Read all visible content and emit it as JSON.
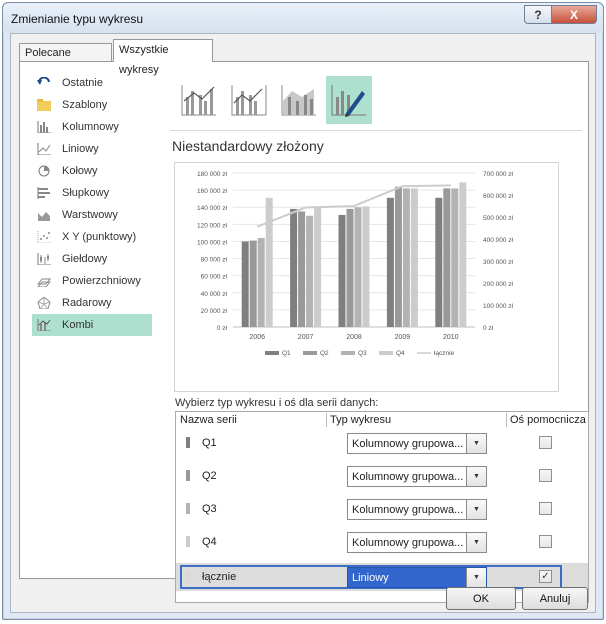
{
  "window": {
    "title": "Zmienianie typu wykresu",
    "help_label": "?",
    "close_label": "X"
  },
  "tabs": [
    {
      "label": "Polecane wykresy"
    },
    {
      "label": "Wszystkie wykresy"
    }
  ],
  "sidebar": {
    "items": [
      {
        "label": "Ostatnie",
        "icon": "undo-icon"
      },
      {
        "label": "Szablony",
        "icon": "folder-icon"
      },
      {
        "label": "Kolumnowy",
        "icon": "column-chart-icon"
      },
      {
        "label": "Liniowy",
        "icon": "line-chart-icon"
      },
      {
        "label": "Kołowy",
        "icon": "pie-chart-icon"
      },
      {
        "label": "Słupkowy",
        "icon": "bar-chart-icon"
      },
      {
        "label": "Warstwowy",
        "icon": "area-chart-icon"
      },
      {
        "label": "X Y (punktowy)",
        "icon": "scatter-chart-icon"
      },
      {
        "label": "Giełdowy",
        "icon": "stock-chart-icon"
      },
      {
        "label": "Powierzchniowy",
        "icon": "surface-chart-icon"
      },
      {
        "label": "Radarowy",
        "icon": "radar-chart-icon"
      },
      {
        "label": "Kombi",
        "icon": "combo-chart-icon",
        "selected": true
      }
    ]
  },
  "subtypes": {
    "selected_index": 3
  },
  "preview": {
    "title": "Niestandardowy złożony"
  },
  "chart_data": {
    "type": "bar",
    "categories": [
      "2006",
      "2007",
      "2008",
      "2009",
      "2010"
    ],
    "series": [
      {
        "name": "Q1",
        "type": "bar",
        "axis": "primary",
        "color": "#7f7f7f",
        "values": [
          100000,
          138000,
          131000,
          151000,
          151000
        ]
      },
      {
        "name": "Q2",
        "type": "bar",
        "axis": "primary",
        "color": "#999999",
        "values": [
          101000,
          135000,
          138000,
          164000,
          162000
        ]
      },
      {
        "name": "Q3",
        "type": "bar",
        "axis": "primary",
        "color": "#b3b3b3",
        "values": [
          104000,
          130000,
          140000,
          162000,
          162000
        ]
      },
      {
        "name": "Q4",
        "type": "bar",
        "axis": "primary",
        "color": "#cccccc",
        "values": [
          151000,
          140000,
          141000,
          162000,
          169000
        ]
      },
      {
        "name": "łącznie",
        "type": "line",
        "axis": "secondary",
        "color": "#cccccc",
        "values": [
          456000,
          543000,
          550000,
          640000,
          644000
        ]
      }
    ],
    "ylim": [
      0,
      180000
    ],
    "y2lim": [
      0,
      700000
    ],
    "y_ticks": [
      "0 zł",
      "20 000 zł",
      "40 000 zł",
      "60 000 zł",
      "80 000 zł",
      "100 000 zł",
      "120 000 zł",
      "140 000 zł",
      "160 000 zł",
      "180 000 zł"
    ],
    "y2_ticks": [
      "0 zł",
      "100 000 zł",
      "200 000 zł",
      "300 000 zł",
      "400 000 zł",
      "500 000 zł",
      "600 000 zł",
      "700 000 zł"
    ],
    "legend_position": "bottom",
    "grid": true
  },
  "series_table": {
    "prompt": "Wybierz typ wykresu i oś dla serii danych:",
    "headers": {
      "name": "Nazwa serii",
      "type": "Typ wykresu",
      "axis": "Oś pomocnicza"
    },
    "rows": [
      {
        "name": "Q1",
        "type": "Kolumnowy grupowa...",
        "secondary": false
      },
      {
        "name": "Q2",
        "type": "Kolumnowy grupowa...",
        "secondary": false
      },
      {
        "name": "Q3",
        "type": "Kolumnowy grupowa...",
        "secondary": false
      },
      {
        "name": "Q4",
        "type": "Kolumnowy grupowa...",
        "secondary": false
      },
      {
        "name": "łącznie",
        "type": "Liniowy",
        "secondary": true
      }
    ]
  },
  "buttons": {
    "ok": "OK",
    "cancel": "Anuluj"
  }
}
